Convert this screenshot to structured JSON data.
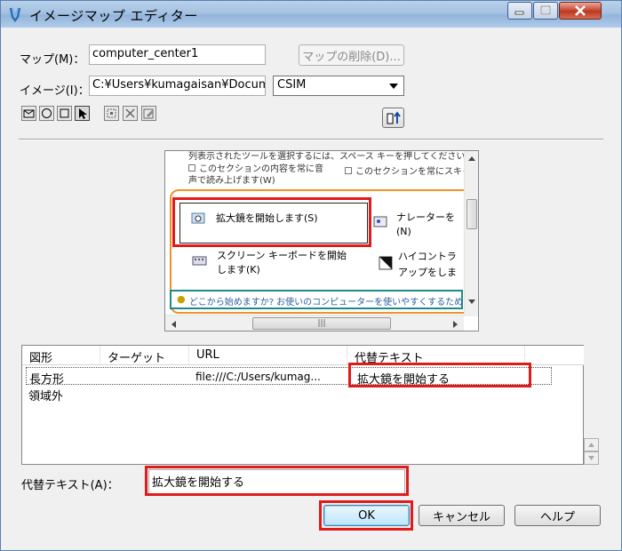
{
  "window": {
    "title": "イメージマップ エディター",
    "controls": [
      "minimize",
      "maximize",
      "close"
    ]
  },
  "map": {
    "label": "マップ(M)：",
    "value": "computer_center1",
    "delete_button": "マップの削除(D)..."
  },
  "image": {
    "label": "イメージ(I)：",
    "value": "C:¥Users¥kumagaisan¥Docume",
    "format_selected": "CSIM"
  },
  "tools": [
    "rectangle-tool",
    "circle-tool",
    "polygon-tool",
    "pointer-tool",
    "select-area-tool",
    "delete-area-tool",
    "edit-area-tool"
  ],
  "preview": {
    "header_text": "列表示されたツールを選択するには、スペース キーを押してください。",
    "check1": "このセクションの内容を常に音声で読み上げます(W)",
    "check2": "このセクションを常にスキャン",
    "item1": "拡大鏡を開始します(S)",
    "item2": "ナレーターを",
    "item2_key": "(N)",
    "item3": "スクリーン キーボードを開始します(K)",
    "item4": "ハイコントラ",
    "item4_sub": "アップをしま",
    "banner": "どこから始めますか? お使いのコンピューターを使いやすくするための推奨事"
  },
  "table": {
    "columns": [
      "図形",
      "ターゲット",
      "URL",
      "代替テキスト"
    ],
    "rows": [
      {
        "shape": "長方形",
        "target": "",
        "url": "file:///C:/Users/kumag...",
        "alt": "拡大鏡を開始する"
      },
      {
        "shape": "領域外",
        "target": "",
        "url": "",
        "alt": ""
      }
    ]
  },
  "alt_text": {
    "label": "代替テキスト(A)：",
    "value": "拡大鏡を開始する"
  },
  "buttons": {
    "ok": "OK",
    "cancel": "キャンセル",
    "help": "ヘルプ"
  },
  "colors": {
    "highlight": "#e11a1a",
    "orange_frame": "#f0922a",
    "teal_banner": "#1d8a8a"
  }
}
